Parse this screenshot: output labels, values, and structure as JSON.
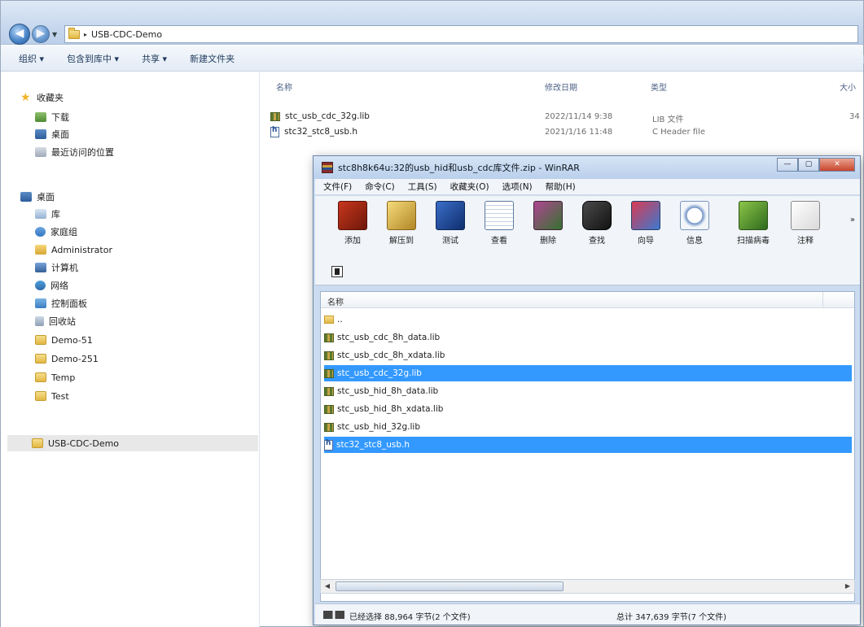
{
  "explorer": {
    "address": {
      "path": "USB-CDC-Demo"
    },
    "commands": [
      "组织 ▾",
      "包含到库中 ▾",
      "共享 ▾",
      "新建文件夹"
    ],
    "nav": {
      "favorites": {
        "title": "收藏夹",
        "items": [
          "下载",
          "桌面",
          "最近访问的位置"
        ]
      },
      "desktop": {
        "title": "桌面",
        "items": [
          "库",
          "家庭组",
          "Administrator",
          "计算机",
          "网络",
          "控制面板",
          "回收站",
          "Demo-51",
          "Demo-251",
          "Temp",
          "Test",
          "USB-CDC-Demo"
        ]
      }
    },
    "columns": {
      "name": "名称",
      "date": "修改日期",
      "type": "类型",
      "size": "大小"
    },
    "files": [
      {
        "name": "stc_usb_cdc_32g.lib",
        "date": "2022/11/14 9:38",
        "type": "LIB 文件",
        "size": "34"
      },
      {
        "name": "stc32_stc8_usb.h",
        "date": "2021/1/16 11:48",
        "type": "C Header file",
        "size": ""
      }
    ]
  },
  "winrar": {
    "title": "stc8h8k64u:32的usb_hid和usb_cdc库文件.zip - WinRAR",
    "window_buttons": [
      "—",
      "▢",
      "✕"
    ],
    "menu": [
      "文件(F)",
      "命令(C)",
      "工具(S)",
      "收藏夹(O)",
      "选项(N)",
      "帮助(H)"
    ],
    "toolbar": [
      {
        "label": "添加",
        "icon": "add-icon"
      },
      {
        "label": "解压到",
        "icon": "extract-icon"
      },
      {
        "label": "测试",
        "icon": "test-icon"
      },
      {
        "label": "查看",
        "icon": "view-icon"
      },
      {
        "label": "删除",
        "icon": "delete-icon"
      },
      {
        "label": "查找",
        "icon": "find-icon"
      },
      {
        "label": "向导",
        "icon": "wizard-icon"
      },
      {
        "label": "信息",
        "icon": "info-icon"
      },
      {
        "label": "扫描病毒",
        "icon": "virus-scan-icon"
      },
      {
        "label": "注释",
        "icon": "comment-icon"
      }
    ],
    "more": "»",
    "list_header": "名称",
    "rows": [
      {
        "name": "..",
        "kind": "up",
        "selected": false
      },
      {
        "name": "stc_usb_cdc_8h_data.lib",
        "kind": "lib",
        "selected": false
      },
      {
        "name": "stc_usb_cdc_8h_xdata.lib",
        "kind": "lib",
        "selected": false
      },
      {
        "name": "stc_usb_cdc_32g.lib",
        "kind": "lib",
        "selected": true
      },
      {
        "name": "stc_usb_hid_8h_data.lib",
        "kind": "lib",
        "selected": false
      },
      {
        "name": "stc_usb_hid_8h_xdata.lib",
        "kind": "lib",
        "selected": false
      },
      {
        "name": "stc_usb_hid_32g.lib",
        "kind": "lib",
        "selected": false
      },
      {
        "name": "stc32_stc8_usb.h",
        "kind": "h",
        "selected": true
      }
    ],
    "status_left": "已经选择 88,964 字节(2 个文件)",
    "status_right": "总计 347,639 字节(7 个文件)"
  }
}
